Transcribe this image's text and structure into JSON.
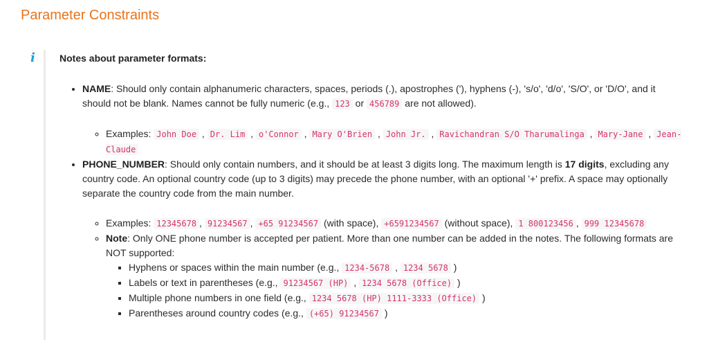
{
  "title": "Parameter Constraints",
  "callout": {
    "icon": "i",
    "heading": "Notes about parameter formats:"
  },
  "name": {
    "label": "NAME",
    "desc1": ": Should only contain alphanumeric characters, spaces, periods (.), apostrophes ('), hyphens (-), 's/o', 'd/o', 'S/O', or 'D/O', and it should not be blank. Names cannot be fully numeric (e.g., ",
    "num1": "123",
    "or": "or",
    "num2": "456789",
    "desc2": "are not allowed).",
    "examples_label": "Examples:",
    "examples": [
      "John Doe",
      "Dr. Lim",
      "o'Connor",
      "Mary O'Brien",
      "John Jr.",
      "Ravichandran S/O Tharumalinga",
      "Mary-Jane",
      "Jean-Claude"
    ]
  },
  "phone": {
    "label": "PHONE_NUMBER",
    "desc1": ": Should only contain numbers, and it should be at least 3 digits long. The maximum length is ",
    "max": "17 digits",
    "desc2": ", excluding any country code. An optional country code (up to 3 digits) may precede the phone number, with an optional '+' prefix. A space may optionally separate the country code from the main number.",
    "examples_label": "Examples:",
    "ex1": "12345678",
    "ex2": "91234567",
    "ex3": "+65 91234567",
    "ex3_note": "(with space),",
    "ex4": "+6591234567",
    "ex4_note": "(without space),",
    "ex5": "1 800123456",
    "ex6": "999 12345678",
    "note_label": "Note",
    "note_text": ": Only ONE phone number is accepted per patient. More than one number can be added in the notes. The following formats are NOT supported:",
    "unsupported": [
      {
        "text": "Hyphens or spaces within the main number (e.g., ",
        "codes": [
          "1234-5678",
          "1234 5678"
        ],
        "end": ")"
      },
      {
        "text": "Labels or text in parentheses (e.g., ",
        "codes": [
          "91234567 (HP)",
          "1234 5678 (Office)"
        ],
        "end": ")"
      },
      {
        "text": "Multiple phone numbers in one field (e.g., ",
        "codes": [
          "1234 5678 (HP) 1111-3333 (Office)"
        ],
        "end": ")"
      },
      {
        "text": "Parentheses around country codes (e.g., ",
        "codes": [
          "(+65) 91234567"
        ],
        "end": ")"
      }
    ]
  }
}
